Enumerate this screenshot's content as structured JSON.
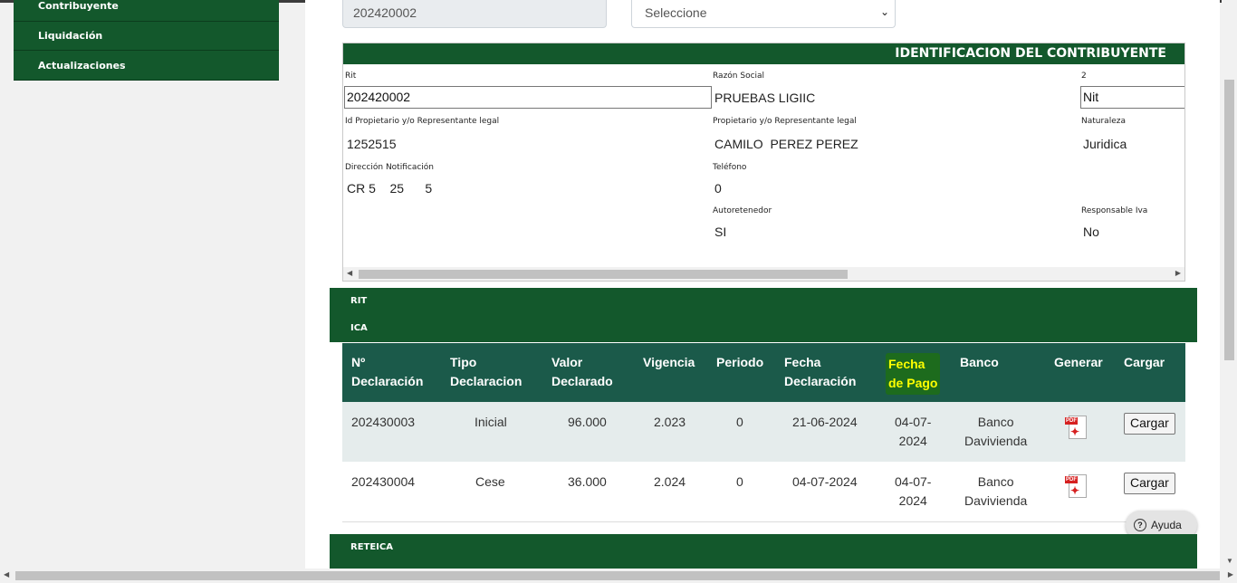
{
  "sidebar": {
    "items": [
      {
        "label": "Contribuyente"
      },
      {
        "label": "Liquidación"
      },
      {
        "label": "Actualizaciones"
      }
    ]
  },
  "top": {
    "rit_value": "202420002",
    "select_value": "Seleccione"
  },
  "identificacion": {
    "title": "IDENTIFICACION DEL CONTRIBUYENTE",
    "rit_label": "Rit",
    "rit_value": "202420002",
    "razon_label": "Razón Social",
    "razon_value": "PRUEBAS LIGIIC",
    "tipo_label": "2",
    "tipo_value": "Nit",
    "id_prop_label": "Id Propietario y/o Representante legal",
    "id_prop_value": "1252515",
    "prop_label": "Propietario y/o Representante legal",
    "prop_value": "CAMILO  PEREZ PEREZ",
    "naturaleza_label": "Naturaleza",
    "naturaleza_value": "Juridica",
    "direccion_label": "Dirección Notificación",
    "direccion_value": "CR 5    25      5",
    "telefono_label": "Teléfono",
    "telefono_value": "0",
    "autoretenedor_label": "Autoretenedor",
    "autoretenedor_value": "SI",
    "responsable_label": "Responsable Iva",
    "responsable_value": "No"
  },
  "sections": {
    "rit": "RIT",
    "ica": "ICA",
    "reteica": "RETEICA"
  },
  "table": {
    "headers": {
      "n_line1": "Nº",
      "n_line2": "Declaración",
      "tipo_line1": "Tipo",
      "tipo_line2": "Declaracion",
      "valor_line1": "Valor",
      "valor_line2": "Declarado",
      "vigencia": "Vigencia",
      "periodo": "Periodo",
      "fecha_decl_line1": "Fecha",
      "fecha_decl_line2": "Declaración",
      "fecha_pago_line1": "Fecha",
      "fecha_pago_line2": "de Pago",
      "banco": "Banco",
      "generar": "Generar",
      "cargar": "Cargar"
    },
    "rows": [
      {
        "numero": "202430003",
        "tipo": "Inicial",
        "valor": "96.000",
        "vigencia": "2.023",
        "periodo": "0",
        "fecha_declaracion": "21-06-2024",
        "fecha_pago_l1": "04-07-",
        "fecha_pago_l2": "2024",
        "banco_l1": "Banco",
        "banco_l2": "Davivienda",
        "cargar": "Cargar"
      },
      {
        "numero": "202430004",
        "tipo": "Cese",
        "valor": "36.000",
        "vigencia": "2.024",
        "periodo": "0",
        "fecha_declaracion": "04-07-2024",
        "fecha_pago_l1": "04-07-",
        "fecha_pago_l2": "2024",
        "banco_l1": "Banco",
        "banco_l2": "Davivienda",
        "cargar": "Cargar"
      }
    ]
  },
  "help": {
    "label": "Ayuda"
  },
  "colors": {
    "green": "#13582c",
    "table_header": "#1b5a4a",
    "highlight": "#ffff00"
  }
}
